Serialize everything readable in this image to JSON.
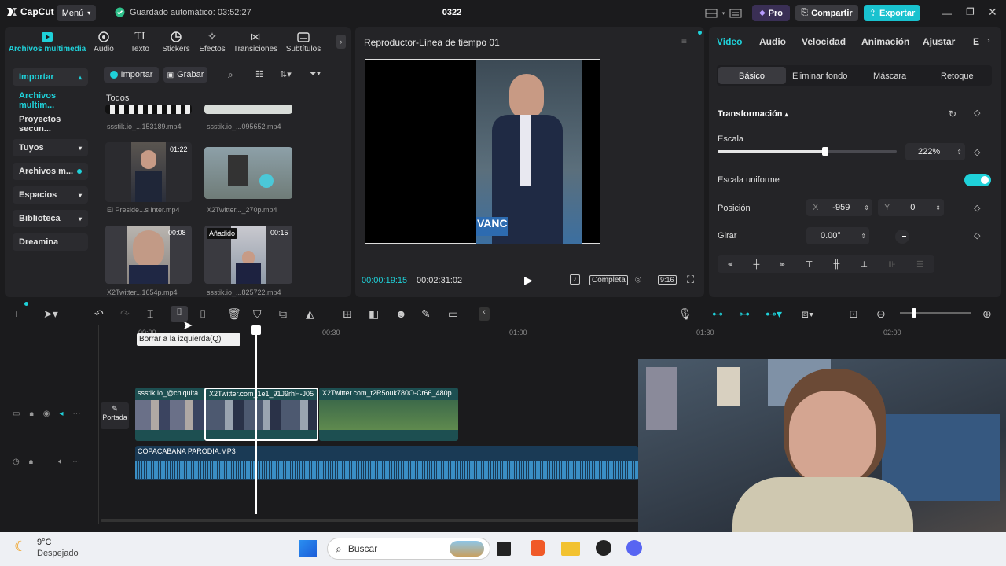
{
  "app": {
    "logo_text": "CapCut",
    "menu_label": "Menú",
    "autosave": "Guardado automático: 03:52:27",
    "project_title": "0322",
    "pro_label": "Pro",
    "share_label": "Compartir",
    "export_label": "Exportar"
  },
  "media_tabs": [
    {
      "label": "Archivos multimedia",
      "icon": "media-icon"
    },
    {
      "label": "Audio",
      "icon": "audio-icon"
    },
    {
      "label": "Texto",
      "icon": "text-icon"
    },
    {
      "label": "Stickers",
      "icon": "sticker-icon"
    },
    {
      "label": "Efectos",
      "icon": "effects-icon"
    },
    {
      "label": "Transiciones",
      "icon": "transitions-icon"
    },
    {
      "label": "Subtítulos",
      "icon": "subtitles-icon"
    }
  ],
  "sidebar": [
    {
      "label": "Importar"
    },
    {
      "label": "Archivos multim..."
    },
    {
      "label": "Proyectos secun..."
    },
    {
      "label": "Tuyos"
    },
    {
      "label": "Archivos m..."
    },
    {
      "label": "Espacios"
    },
    {
      "label": "Biblioteca"
    },
    {
      "label": "Dreamina"
    }
  ],
  "media_toolbar": {
    "import_label": "Importar",
    "record_label": "Grabar",
    "section_label": "Todos"
  },
  "media_items": [
    {
      "name": "ssstik.io_...153189.mp4",
      "duration": ""
    },
    {
      "name": "ssstik.io_...095652.mp4",
      "duration": ""
    },
    {
      "name": "El Preside...s inter.mp4",
      "duration": "01:22"
    },
    {
      "name": "X2Twitter..._270p.mp4",
      "duration": ""
    },
    {
      "name": "X2Twitter...1654p.mp4",
      "duration": "00:08"
    },
    {
      "name": "ssstik.io_...825722.mp4",
      "duration": "00:15",
      "badge": "Añadido"
    }
  ],
  "player": {
    "title": "Reproductor-Línea de tiempo 01",
    "current_time": "00:00:19:15",
    "total_time": "00:02:31:02",
    "quality_label": "Completa",
    "ratio_label": "9:16",
    "video_banner": "VANC"
  },
  "inspector": {
    "tabs": [
      "Video",
      "Audio",
      "Velocidad",
      "Animación",
      "Ajustar",
      "E"
    ],
    "subtabs": [
      "Básico",
      "Eliminar fondo",
      "Máscara",
      "Retoque"
    ],
    "section": "Transformación",
    "scale_label": "Escala",
    "scale_value": "222%",
    "scale_level": 0.6,
    "uniform_label": "Escala uniforme",
    "position_label": "Posición",
    "x_label": "X",
    "x_value": "-959",
    "y_label": "Y",
    "y_value": "0",
    "rotate_label": "Girar",
    "rotate_value": "0.00°"
  },
  "timeline": {
    "tooltip": "Borrar a la izquierda(Q)",
    "ruler": [
      "00:00",
      "00:30",
      "01:00",
      "01:30",
      "02:00"
    ],
    "cover_label": "Portada",
    "clips": [
      {
        "label": "ssstik.io_@chiquita"
      },
      {
        "label": "X2Twitter.com_1e1_91J9rhH-J05"
      },
      {
        "label": "X2Twitter.com_t2R5ouk780O-Cr66_480p"
      }
    ],
    "audio_clip": "COPACABANA PARODIA.MP3"
  },
  "taskbar": {
    "temp": "9°C",
    "weather": "Despejado",
    "search": "Buscar"
  },
  "colors": {
    "accent": "#1fd1d9",
    "export": "#19c2cf",
    "bg": "#1b1b1d",
    "panel": "#242427"
  }
}
